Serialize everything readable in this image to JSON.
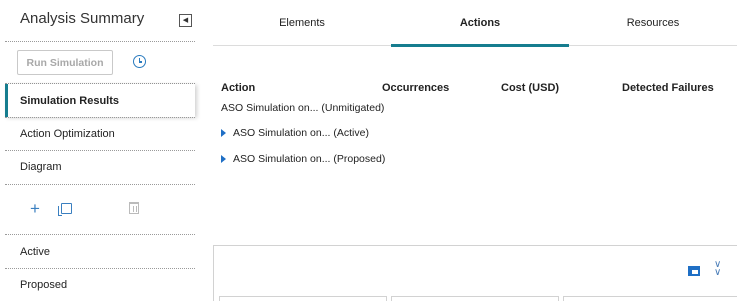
{
  "sidebar": {
    "title": "Analysis Summary",
    "collapse_icon": "chevron-left-icon",
    "run_button_label": "Run Simulation",
    "history_icon": "clock-icon",
    "nav_items": [
      {
        "label": "Simulation Results",
        "selected": true
      },
      {
        "label": "Action Optimization",
        "selected": false
      },
      {
        "label": "Diagram",
        "selected": false
      }
    ],
    "toolbar_icons": [
      "plus-icon",
      "copy-icon",
      "trash-icon"
    ],
    "scenarios": [
      {
        "label": "Active"
      },
      {
        "label": "Proposed"
      }
    ]
  },
  "main": {
    "tabs": [
      {
        "label": "Elements",
        "active": false
      },
      {
        "label": "Actions",
        "active": true
      },
      {
        "label": "Resources",
        "active": false
      }
    ],
    "columns": [
      "Action",
      "Occurrences",
      "Cost (USD)",
      "Detected Failures"
    ],
    "rows": [
      {
        "label": "ASO Simulation on... (Unmitigated)",
        "expandable": false
      },
      {
        "label": "ASO Simulation on... (Active)",
        "expandable": true
      },
      {
        "label": "ASO Simulation on... (Proposed)",
        "expandable": true
      }
    ],
    "bottom_panel_icons": [
      "panel-layout-icon",
      "double-chevron-down-icon"
    ]
  },
  "colors": {
    "accent": "#167d8f",
    "icon_blue": "#1f6fc5",
    "disabled_text": "#a8a8a8"
  }
}
